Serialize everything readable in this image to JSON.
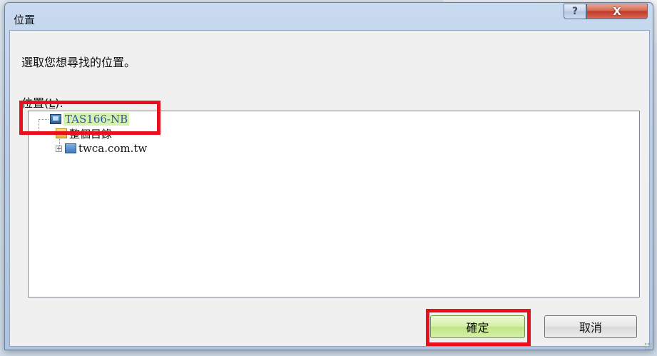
{
  "dialog": {
    "title": "位置",
    "help_glyph": "?",
    "close_glyph": "X"
  },
  "content": {
    "prompt": "選取您想尋找的位置。",
    "location_label": "位置(",
    "location_hotkey": "L",
    "location_label_end": "):"
  },
  "tree": {
    "items": [
      {
        "label": "TAS166-NB",
        "icon": "computer-icon",
        "selected": true
      },
      {
        "label": "整個目錄",
        "icon": "folder-icon",
        "expanded": true
      },
      {
        "label": "twca.com.tw",
        "icon": "domain-icon",
        "expanded": false
      }
    ],
    "expander_collapsed": "+"
  },
  "buttons": {
    "ok": "確定",
    "cancel": "取消"
  },
  "colors": {
    "highlight_box": "#e8101a",
    "ok_button": "#d2efa3"
  }
}
